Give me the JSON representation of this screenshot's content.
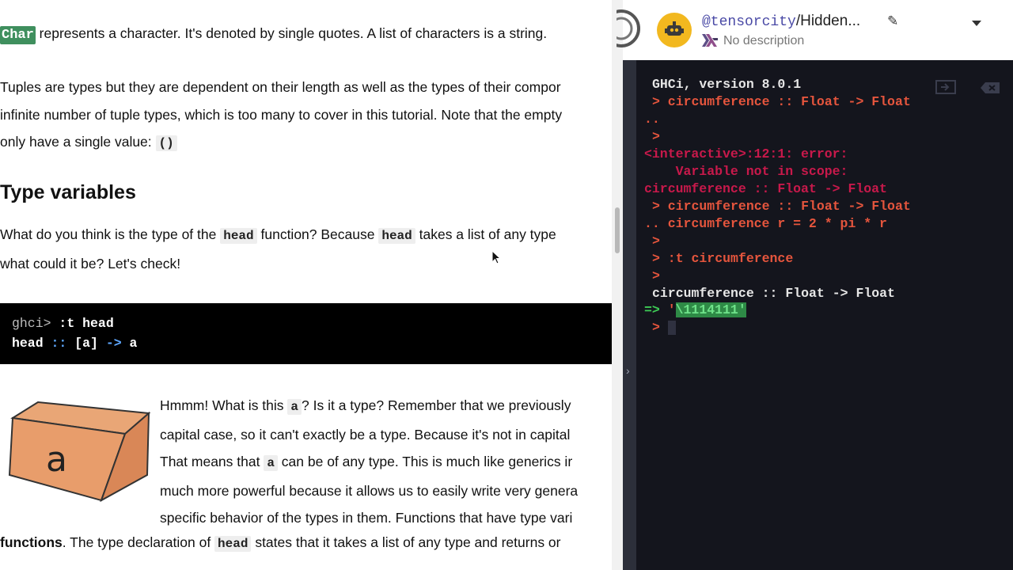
{
  "tutorial": {
    "p1": {
      "char": "Char",
      "rest": " represents a character. It's denoted by single quotes. A list of characters is a string."
    },
    "p2": {
      "line1": "Tuples are types but they are dependent on their length as well as the types of their compor",
      "line2": "infinite number of tuple types, which is too many to cover in this tutorial. Note that the empty",
      "line3_pre": "only have a single value: ",
      "line3_code": "()"
    },
    "heading": "Type variables",
    "p3": {
      "l1_a": "What do you think is the type of the ",
      "l1_code1": "head",
      "l1_b": " function? Because ",
      "l1_code2": "head",
      "l1_c": " takes a list of any type",
      "l2": "what could it be? Let's check!"
    },
    "codeblock": {
      "prompt": "ghci>",
      "cmd": " :t head",
      "l2_a": "head ",
      "l2_op1": "::",
      "l2_b": " [a] ",
      "l2_op2": "->",
      "l2_c": " a"
    },
    "p4": {
      "l1_a": "Hmmm! What is this ",
      "l1_code": "a",
      "l1_b": "? Is it a type? Remember that we previously",
      "l2": "capital case, so it can't exactly be a type. Because it's not in capital",
      "l3_a": "That means that ",
      "l3_code": "a",
      "l3_b": " can be of any type. This is much like generics ir",
      "l4": "much more powerful because it allows us to easily write very genera",
      "l5": "specific behavior of the types in them. Functions that have type vari",
      "l6_bold": "functions",
      "l6_a": ". The type declaration of ",
      "l6_code": "head",
      "l6_b": " states that it takes a list of any type and returns or"
    },
    "box_letter": "a"
  },
  "repl": {
    "user": "@tensorcity",
    "slash_name": "/Hidden...",
    "description": "No description"
  },
  "console": {
    "lines": [
      {
        "cls": "white",
        "x": 20,
        "text": "GHCi, version 8.0.1"
      },
      {
        "cls": "orange",
        "x": 20,
        "text": "> circumference :: Float -> Float"
      },
      {
        "cls": "orange",
        "x": 10,
        "text": ".."
      },
      {
        "cls": "orange",
        "x": 20,
        "text": ">"
      },
      {
        "cls": "red",
        "x": 10,
        "text": "<interactive>:12:1: error:"
      },
      {
        "cls": "red",
        "x": 10,
        "text": "    Variable not in scope:"
      },
      {
        "cls": "red",
        "x": 10,
        "text": "circumference :: Float -> Float"
      },
      {
        "cls": "orange",
        "x": 20,
        "text": "> circumference :: Float -> Float"
      },
      {
        "cls": "orange",
        "x": 10,
        "text": ".. circumference r = 2 * pi * r"
      },
      {
        "cls": "orange",
        "x": 20,
        "text": ">"
      },
      {
        "cls": "orange",
        "x": 20,
        "text": "> :t circumference"
      },
      {
        "cls": "orange",
        "x": 20,
        "text": ">"
      },
      {
        "cls": "white",
        "x": 20,
        "text": "circumference :: Float -> Float"
      }
    ],
    "result_arrow": "=>",
    "result_q1": "'",
    "result_sel": "\\1114111'",
    "final_prompt": ">"
  }
}
